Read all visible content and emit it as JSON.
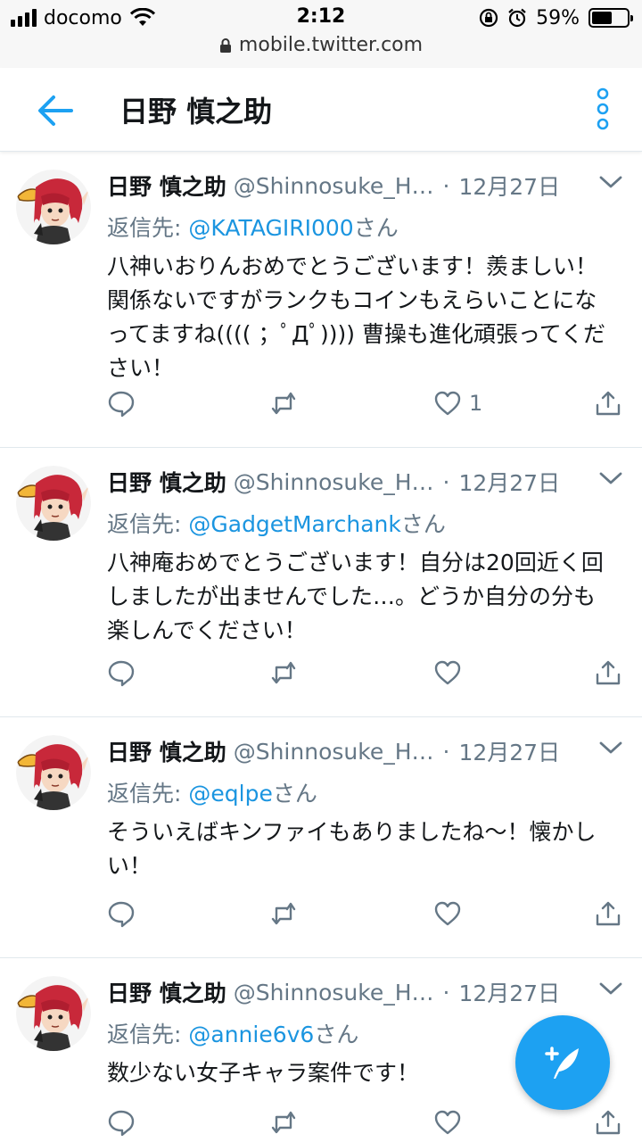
{
  "status_bar": {
    "carrier": "docomo",
    "time": "2:12",
    "battery_percent": "59%",
    "battery_level": 0.59,
    "url": "mobile.twitter.com"
  },
  "header": {
    "title": "日野 慎之助"
  },
  "colors": {
    "accent": "#1da1f2",
    "link": "#1b95e0",
    "muted": "#657786"
  },
  "tweets": [
    {
      "name": "日野 慎之助",
      "handle": "@Shinnosuke_H…",
      "dot": "·",
      "date": "12月27日",
      "reply_prefix": "返信先: ",
      "reply_to": "@KATAGIRI000",
      "reply_suffix": "さん",
      "text": "八神いおりんおめでとうございます！羨ましい！関係ないですがランクもコインもえらいことになってますね(((( ；ﾟДﾟ)))) 曹操も進化頑張ってください！",
      "like_count": "1"
    },
    {
      "name": "日野 慎之助",
      "handle": "@Shinnosuke_H…",
      "dot": "·",
      "date": "12月27日",
      "reply_prefix": "返信先: ",
      "reply_to": "@GadgetMarchank",
      "reply_suffix": "さん",
      "text": "八神庵おめでとうございます！自分は20回近く回しましたが出ませんでした…。どうか自分の分も楽しんでください！",
      "like_count": ""
    },
    {
      "name": "日野 慎之助",
      "handle": "@Shinnosuke_H…",
      "dot": "·",
      "date": "12月27日",
      "reply_prefix": "返信先: ",
      "reply_to": "@eqlpe",
      "reply_suffix": "さん",
      "text": "そういえばキンファイもありましたね〜！懐かしい！",
      "like_count": ""
    },
    {
      "name": "日野 慎之助",
      "handle": "@Shinnosuke_H…",
      "dot": "·",
      "date": "12月27日",
      "reply_prefix": "返信先: ",
      "reply_to": "@annie6v6",
      "reply_suffix": "さん",
      "text": "数少ない女子キャラ案件です！",
      "like_count": ""
    }
  ],
  "icons": {
    "back": "arrow-left",
    "more": "vertical-dots",
    "caret": "chevron-down",
    "reply": "speech-bubble",
    "retweet": "retweet-arrows",
    "like": "heart",
    "share": "share-upload",
    "compose": "feather-plus"
  }
}
